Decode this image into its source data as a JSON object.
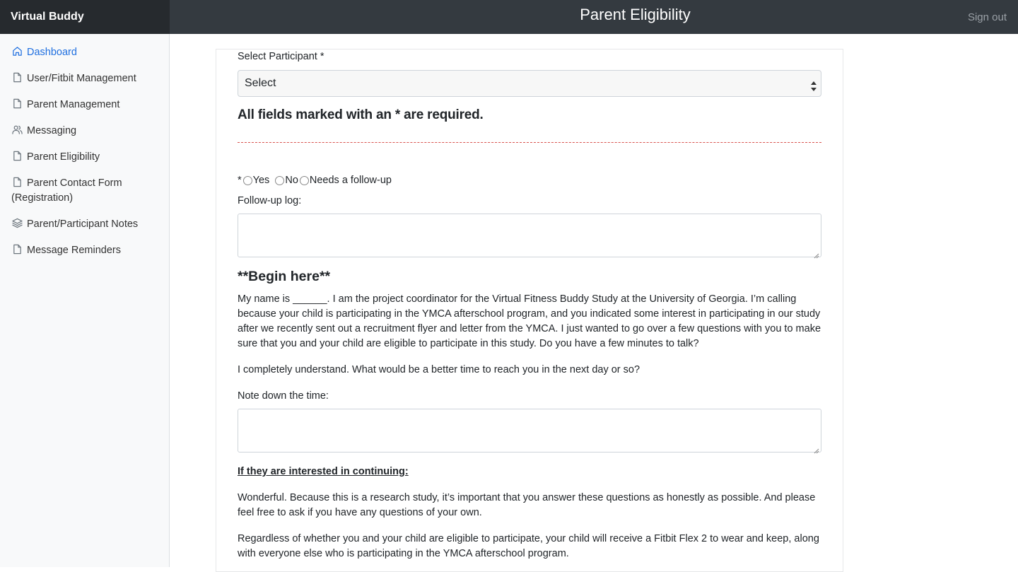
{
  "header": {
    "brand": "Virtual Buddy",
    "title": "Parent Eligibility",
    "signout": "Sign out"
  },
  "sidebar": {
    "items": [
      {
        "label": "Dashboard",
        "icon": "home-icon"
      },
      {
        "label": "User/Fitbit Management",
        "icon": "file-icon"
      },
      {
        "label": "Parent Management",
        "icon": "file-icon"
      },
      {
        "label": "Messaging",
        "icon": "users-icon"
      },
      {
        "label": "Parent Eligibility",
        "icon": "file-icon"
      },
      {
        "label": "Parent Contact Form",
        "label2": "(Registration)",
        "icon": "file-icon"
      },
      {
        "label": "Parent/Participant Notes",
        "icon": "layers-icon"
      },
      {
        "label": "Message Reminders",
        "icon": "file-icon"
      }
    ]
  },
  "form": {
    "participant_label": "Select Participant *",
    "participant_value": "Select",
    "required_note": "All fields marked with an * are required.",
    "radio_star": "*",
    "radio_options": [
      "Yes",
      "No",
      "Needs a follow-up"
    ],
    "followup_label": "Follow-up log:",
    "begin_heading": "**Begin here**",
    "intro": "My name is ______. I am the project coordinator for the Virtual Fitness Buddy Study at the University of Georgia. I’m calling because your child is participating in the YMCA afterschool program, and you indicated some interest in participating in our study after we recently sent out a recruitment flyer and letter from the YMCA. I just wanted to go over a few questions with you to make sure that you and your child are eligible to participate in this study. Do you have a few minutes to talk?",
    "understand": "I completely understand. What would be a better time to reach you in the next day or so?",
    "note_time_label": "Note down the time:",
    "continue_heading": "If they are interested in continuing:",
    "wonderful": "Wonderful. Because this is a research study, it’s important that you answer these questions as honestly as possible. And please feel free to ask if you have any questions of your own.",
    "regardless": "Regardless of whether you and your child are eligible to participate, your child will receive a Fitbit Flex 2 to wear and keep, along with everyone else who is participating in the YMCA afterschool program."
  },
  "colors": {
    "topbar": "#343a40",
    "brand_bg": "#262a2e",
    "active_link": "#1f6fe0",
    "dashed_rule": "#d9534f"
  }
}
